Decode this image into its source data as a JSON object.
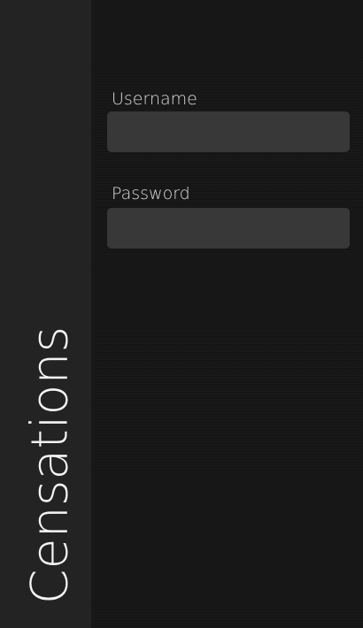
{
  "app": {
    "brand_name": "Censations"
  },
  "login_form": {
    "username_label": "Username",
    "username_value": "",
    "password_label": "Password",
    "password_value": ""
  },
  "colors": {
    "brand_panel_bg": "#232323",
    "form_bg": "#161616",
    "input_bg": "#383838",
    "label_text": "#dddddd",
    "brand_text": "#f4f4f4"
  }
}
